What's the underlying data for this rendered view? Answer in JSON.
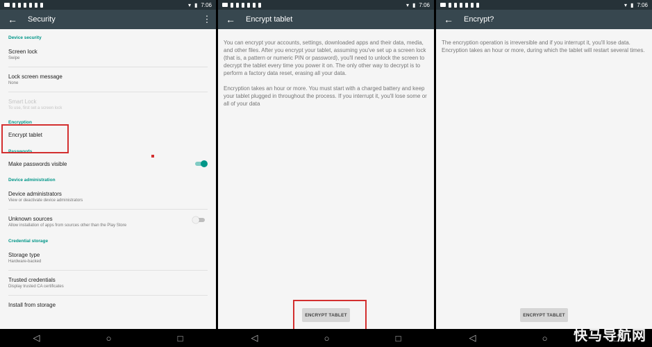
{
  "status": {
    "time": "7:06"
  },
  "icons": {
    "back": "arrow-back-icon",
    "more": "more-vert-icon",
    "nav_back": "triangle-back-icon",
    "nav_home": "circle-home-icon",
    "nav_recent": "square-recent-icon"
  },
  "panel1": {
    "title": "Security",
    "sections": {
      "device_security": "Device security",
      "encryption": "Encryption",
      "passwords": "Passwords",
      "device_admin": "Device administration",
      "credential_storage": "Credential storage"
    },
    "items": {
      "screen_lock": {
        "title": "Screen lock",
        "subtitle": "Swipe"
      },
      "lock_message": {
        "title": "Lock screen message",
        "subtitle": "None"
      },
      "smart_lock": {
        "title": "Smart Lock",
        "subtitle": "To use, first set a screen lock"
      },
      "encrypt_tablet": {
        "title": "Encrypt tablet"
      },
      "make_passwords_visible": {
        "title": "Make passwords visible",
        "on": true
      },
      "device_admins": {
        "title": "Device administrators",
        "subtitle": "View or deactivate device administrators"
      },
      "unknown_sources": {
        "title": "Unknown sources",
        "subtitle": "Allow installation of apps from sources other than the Play Store",
        "on": false
      },
      "storage_type": {
        "title": "Storage type",
        "subtitle": "Hardware-backed"
      },
      "trusted_credentials": {
        "title": "Trusted credentials",
        "subtitle": "Display trusted CA certificates"
      },
      "install_from_storage": {
        "title": "Install from storage"
      }
    }
  },
  "panel2": {
    "title": "Encrypt tablet",
    "para1": "You can encrypt your accounts, settings, downloaded apps and their data, media, and other files. After you encrypt your tablet, assuming you've set up a screen lock (that is, a pattern or numeric PIN or password), you'll need to unlock the screen to decrypt the tablet every time you power it on. The only other way to decrypt is to perform a factory data reset, erasing all your data.",
    "para2": "Encryption takes an hour or more. You must start with a charged battery and keep your tablet plugged in throughout the process. If you interrupt it, you'll lose some or all of your data",
    "button": "ENCRYPT TABLET"
  },
  "panel3": {
    "title": "Encrypt?",
    "para1": "The encryption operation is irreversible and if you interrupt it, you'll lose data. Encryption takes an hour or more, during which the tablet will restart several times.",
    "button": "ENCRYPT TABLET"
  },
  "watermark": "快马导航网",
  "accent_colors": {
    "toolbar": "#37474f",
    "statusbar": "#263238",
    "teal": "#009688",
    "highlight": "#d32f2f"
  }
}
